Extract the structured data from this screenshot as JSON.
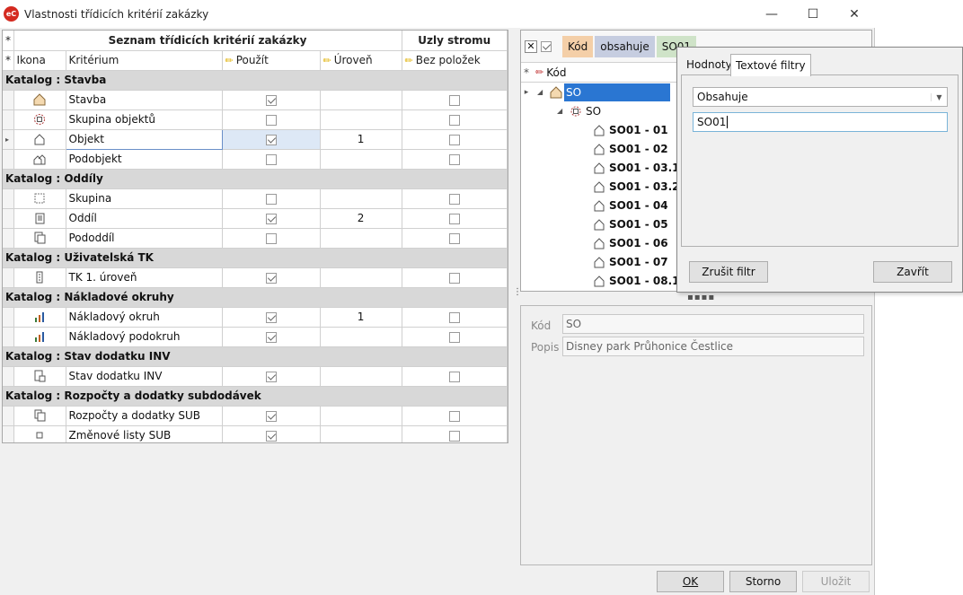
{
  "window": {
    "title": "Vlastnosti třídicích kritérií zakázky",
    "app_icon": "eC"
  },
  "grid": {
    "band1": "Seznam třídicích kritérií zakázky",
    "band2": "Uzly stromu",
    "col_icon": "Ikona",
    "col_crit": "Kritérium",
    "col_use": "Použít",
    "col_level": "Úroveň",
    "col_noitems": "Bez položek",
    "groups": [
      {
        "label": "Katalog : Stavba",
        "rows": [
          {
            "icon": "house-icon",
            "name": "Stavba",
            "use": true,
            "level": "",
            "noitems": false
          },
          {
            "icon": "gear-group-icon",
            "name": "Skupina objektů",
            "use": false,
            "level": "",
            "noitems": false
          },
          {
            "icon": "house-outline-icon",
            "name": "Objekt",
            "use": true,
            "level": "1",
            "noitems": false,
            "selected": true
          },
          {
            "icon": "house-small-icon",
            "name": "Podobjekt",
            "use": false,
            "level": "",
            "noitems": false
          }
        ]
      },
      {
        "label": "Katalog : Oddíly",
        "rows": [
          {
            "icon": "group-icon",
            "name": "Skupina",
            "use": false,
            "level": "",
            "noitems": false
          },
          {
            "icon": "section-icon",
            "name": "Oddíl",
            "use": true,
            "level": "2",
            "noitems": false
          },
          {
            "icon": "subsection-icon",
            "name": "Pododdíl",
            "use": false,
            "level": "",
            "noitems": false
          }
        ]
      },
      {
        "label": "Katalog : Uživatelská TK",
        "rows": [
          {
            "icon": "tk-icon",
            "name": "TK 1. úroveň",
            "use": true,
            "level": "",
            "noitems": false
          }
        ]
      },
      {
        "label": "Katalog : Nákladové okruhy",
        "rows": [
          {
            "icon": "bar-chart-icon",
            "name": "Nákladový okruh",
            "use": true,
            "level": "1",
            "noitems": false
          },
          {
            "icon": "bar-chart-icon",
            "name": "Nákladový podokruh",
            "use": true,
            "level": "",
            "noitems": false
          }
        ]
      },
      {
        "label": "Katalog : Stav dodatku INV",
        "rows": [
          {
            "icon": "doc-status-icon",
            "name": "Stav dodatku INV",
            "use": true,
            "level": "",
            "noitems": false
          }
        ]
      },
      {
        "label": "Katalog : Rozpočty a dodatky subdodávek",
        "rows": [
          {
            "icon": "doc-stack-icon",
            "name": "Rozpočty a dodatky SUB",
            "use": true,
            "level": "",
            "noitems": false
          },
          {
            "icon": "small-square-icon",
            "name": "Změnové listy SUB",
            "use": true,
            "level": "",
            "noitems": false
          }
        ]
      }
    ]
  },
  "filter": {
    "tag_field": "Kód",
    "tag_op": "obsahuje",
    "tag_value": "SO01"
  },
  "tree": {
    "header": "Kód",
    "root": "SO",
    "child": "SO",
    "items": [
      "SO01 - 01",
      "SO01 - 02",
      "SO01 - 03.1",
      "SO01 - 03.2",
      "SO01 - 04",
      "SO01 - 05",
      "SO01 - 06",
      "SO01 - 07",
      "SO01 - 08.1"
    ]
  },
  "detail": {
    "kod_label": "Kód",
    "kod_value": "SO",
    "popis_label": "Popis",
    "popis_value": "Disney park Průhonice Čestlice"
  },
  "popup": {
    "tab1": "Hodnoty",
    "tab2": "Textové filtry",
    "select": "Obsahuje",
    "input": "SO01",
    "clear_btn": "Zrušit filtr",
    "close_btn": "Zavřít"
  },
  "buttons": {
    "ok": "OK",
    "cancel": "Storno",
    "save": "Uložit"
  }
}
